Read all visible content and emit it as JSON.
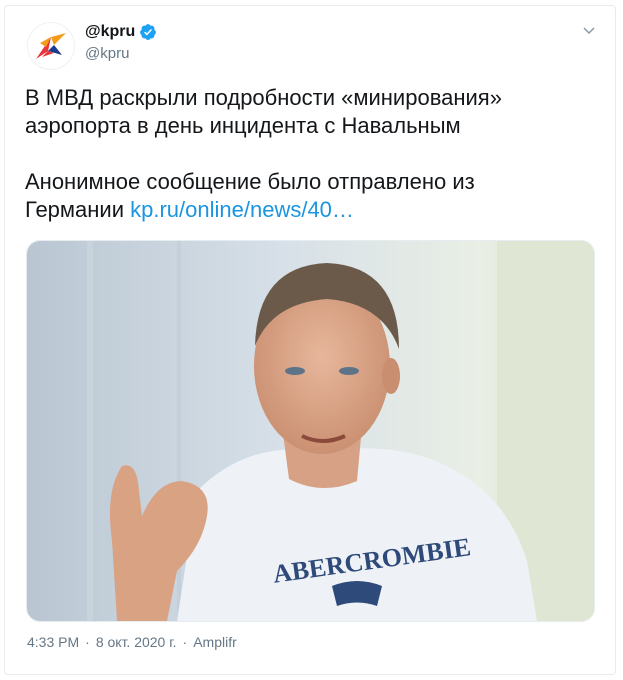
{
  "tweet": {
    "display_name": "@kpru",
    "handle": "@kpru",
    "verified": true,
    "text_line1": "В МВД раскрыли подробности «минирования»",
    "text_line2": "аэропорта в день инцидента с Навальным",
    "text_line3": "Анонимное сообщение было отправлено из",
    "text_line4_prefix": "Германии ",
    "link_text": "kp.ru/online/news/40…",
    "timestamp": "4:33 PM",
    "separator": "·",
    "date": "8 окт. 2020 г.",
    "source": "Amplifr",
    "image_shirt_text": "ABERCROMBIE"
  },
  "colors": {
    "link": "#1b95e0",
    "verified": "#1da1f2",
    "logo_red": "#e8343a",
    "logo_orange": "#f39c1c",
    "logo_blue": "#1e3c8c",
    "secondary": "#657786"
  },
  "icons": {
    "avatar": "kp-logo",
    "verified": "verified-badge-icon",
    "caret": "chevron-down-icon"
  }
}
